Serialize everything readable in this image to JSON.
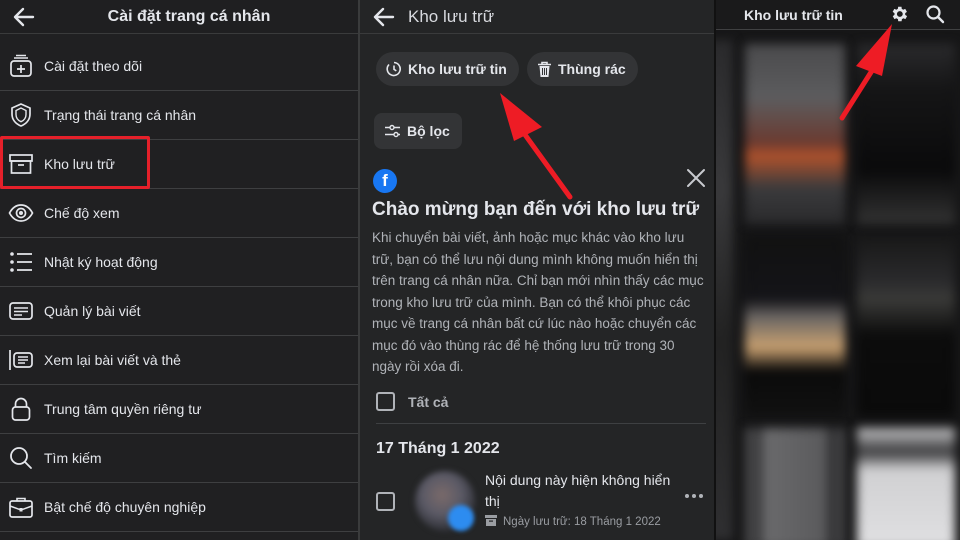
{
  "panel_settings": {
    "title": "Cài đặt trang cá nhân",
    "back_icon": "arrow-left-icon",
    "items": [
      {
        "label": "Cài đặt theo dõi",
        "icon": "follow-settings-icon"
      },
      {
        "label": "Trạng thái trang cá nhân",
        "icon": "shield-icon"
      },
      {
        "label": "Kho lưu trữ",
        "icon": "archive-box-icon",
        "highlighted": true
      },
      {
        "label": "Chế độ xem",
        "icon": "eye-icon"
      },
      {
        "label": "Nhật ký hoạt động",
        "icon": "list-icon"
      },
      {
        "label": "Quản lý bài viết",
        "icon": "posts-icon"
      },
      {
        "label": "Xem lại bài viết và thẻ",
        "icon": "review-posts-icon"
      },
      {
        "label": "Trung tâm quyền riêng tư",
        "icon": "lock-icon"
      },
      {
        "label": "Tìm kiếm",
        "icon": "search-icon"
      },
      {
        "label": "Bật chế độ chuyên nghiệp",
        "icon": "briefcase-icon"
      }
    ]
  },
  "panel_archive": {
    "title": "Kho lưu trữ",
    "chips": {
      "story_archive": "Kho lưu trữ tin",
      "trash": "Thùng rác",
      "filter": "Bộ lọc"
    },
    "welcome": {
      "title": "Chào mừng bạn đến với kho lưu trữ",
      "body": "Khi chuyển bài viết, ảnh hoặc mục khác vào kho lưu trữ, bạn có thể lưu nội dung mình không muốn hiển thị trên trang cá nhân nữa. Chỉ bạn mới nhìn thấy các mục trong kho lưu trữ của mình. Bạn có thể khôi phục các mục về trang cá nhân bất cứ lúc nào hoặc chuyển các mục đó vào thùng rác để hệ thống lưu trữ trong 30 ngày rồi xóa đi."
    },
    "select_all_label": "Tất cả",
    "date_group": "17 Tháng 1 2022",
    "items": [
      {
        "text": "Nội dung này hiện không hiển thị",
        "meta": "Ngày lưu trữ: 18 Tháng 1 2022"
      }
    ]
  },
  "panel_story_archive": {
    "title": "Kho lưu trữ tin",
    "icons": [
      "gear-icon",
      "search-icon"
    ],
    "tiles_count": 6
  },
  "colors": {
    "annotation_red": "#e5202a",
    "facebook_blue": "#1877f2",
    "background_dark": "#242526"
  }
}
